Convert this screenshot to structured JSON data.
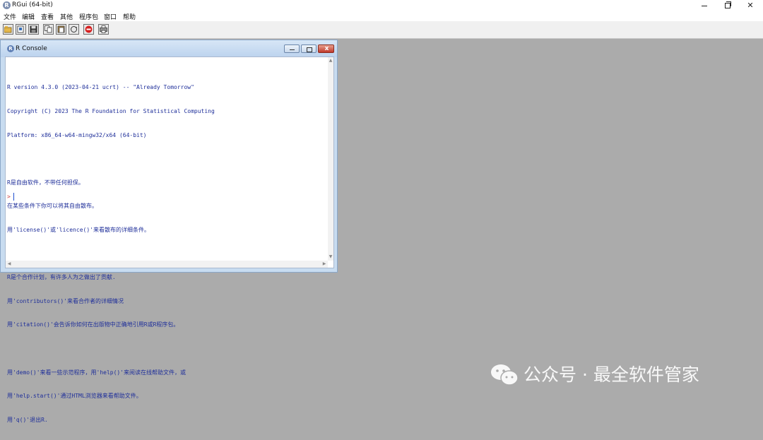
{
  "app": {
    "title": "RGui (64-bit)",
    "icon_letter": "R"
  },
  "menubar": {
    "items": [
      "文件",
      "编辑",
      "查看",
      "其他",
      "程序包",
      "窗口",
      "帮助"
    ]
  },
  "toolbar": {
    "buttons": [
      {
        "name": "open-script-icon"
      },
      {
        "name": "load-workspace-icon"
      },
      {
        "name": "save-workspace-icon"
      },
      {
        "name": "copy-icon"
      },
      {
        "name": "paste-icon"
      },
      {
        "name": "copy-paste-icon"
      },
      {
        "name": "stop-icon"
      },
      {
        "name": "print-icon"
      }
    ]
  },
  "console": {
    "title": "R Console",
    "icon_letter": "R",
    "lines": [
      "R version 4.3.0 (2023-04-21 ucrt) -- \"Already Tomorrow\"",
      "Copyright (C) 2023 The R Foundation for Statistical Computing",
      "Platform: x86_64-w64-mingw32/x64 (64-bit)",
      "",
      "R是自由软件，不带任何担保。",
      "在某些条件下你可以将其自由散布。",
      "用'license()'或'licence()'来看散布的详细条件。",
      "",
      "R是个合作计划，有许多人为之做出了贡献.",
      "用'contributors()'来看合作者的详细情况",
      "用'citation()'会告诉你如何在出版物中正确地引用R或R程序包。",
      "",
      "用'demo()'来看一些示范程序，用'help()'来阅读在线帮助文件，或",
      "用'help.start()'通过HTML浏览器来看帮助文件。",
      "用'q()'退出R."
    ],
    "prompt": ">"
  },
  "watermark": {
    "text": "公众号 · 最全软件管家"
  },
  "colors": {
    "console_text": "#1f2f9a",
    "prompt": "#d04040",
    "desktop": "#ababab"
  }
}
